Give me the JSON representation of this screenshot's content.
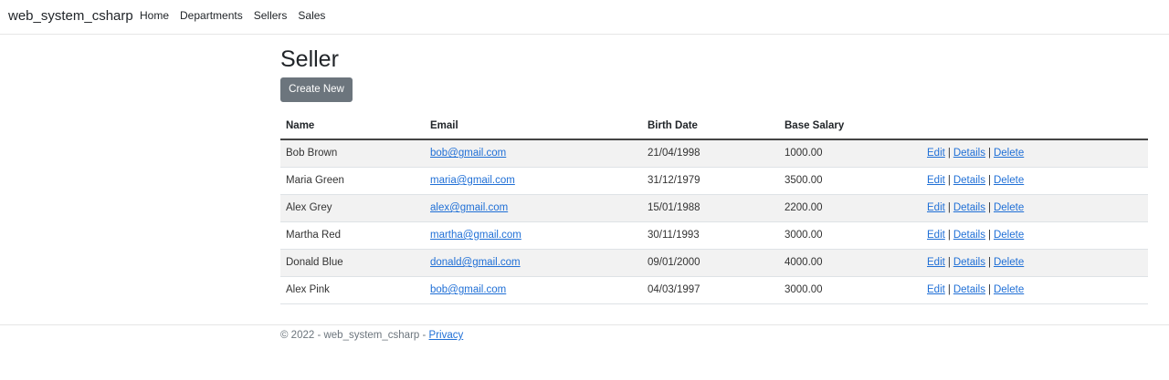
{
  "navbar": {
    "brand": "web_system_csharp",
    "links": [
      "Home",
      "Departments",
      "Sellers",
      "Sales"
    ]
  },
  "page": {
    "title": "Seller",
    "create_button": "Create New"
  },
  "table": {
    "headers": [
      "Name",
      "Email",
      "Birth Date",
      "Base Salary"
    ],
    "rows": [
      {
        "name": "Bob Brown",
        "email": "bob@gmail.com",
        "birth_date": "21/04/1998",
        "base_salary": "1000.00"
      },
      {
        "name": "Maria Green",
        "email": "maria@gmail.com",
        "birth_date": "31/12/1979",
        "base_salary": "3500.00"
      },
      {
        "name": "Alex Grey",
        "email": "alex@gmail.com",
        "birth_date": "15/01/1988",
        "base_salary": "2200.00"
      },
      {
        "name": "Martha Red",
        "email": "martha@gmail.com",
        "birth_date": "30/11/1993",
        "base_salary": "3000.00"
      },
      {
        "name": "Donald Blue",
        "email": "donald@gmail.com",
        "birth_date": "09/01/2000",
        "base_salary": "4000.00"
      },
      {
        "name": "Alex Pink",
        "email": "bob@gmail.com",
        "birth_date": "04/03/1997",
        "base_salary": "3000.00"
      }
    ],
    "actions": {
      "edit": "Edit",
      "details": "Details",
      "delete": "Delete",
      "separator": "|"
    }
  },
  "footer": {
    "text": "© 2022 - web_system_csharp - ",
    "privacy_link": "Privacy"
  },
  "colors": {
    "link": "#1f6fd6",
    "button_bg": "#6c757d",
    "striped_row": "#f2f2f2"
  }
}
